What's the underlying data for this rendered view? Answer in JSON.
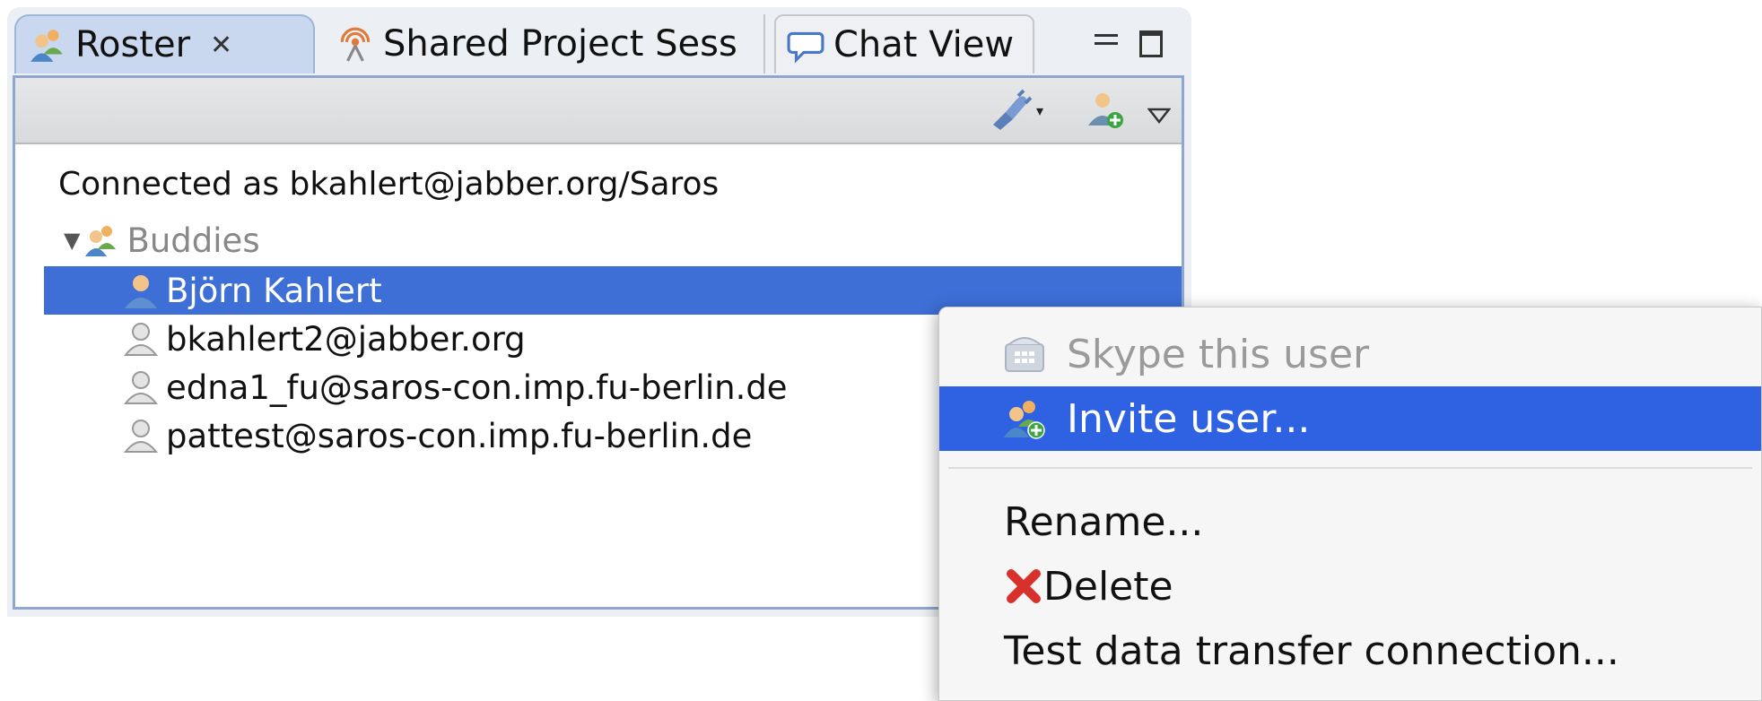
{
  "tabs": {
    "roster": "Roster",
    "roster_close": "✕",
    "shared": "Shared Project Sess",
    "chat": "Chat View"
  },
  "roster": {
    "status": "Connected as bkahlert@jabber.org/Saros",
    "group_label": "Buddies",
    "contacts": [
      {
        "name": "Björn Kahlert",
        "selected": true
      },
      {
        "name": "bkahlert2@jabber.org",
        "selected": false
      },
      {
        "name": "edna1_fu@saros-con.imp.fu-berlin.de",
        "selected": false
      },
      {
        "name": "pattest@saros-con.imp.fu-berlin.de",
        "selected": false
      }
    ]
  },
  "context_menu": {
    "items": [
      {
        "label": "Skype this user",
        "enabled": false,
        "icon": "skype-phone-icon"
      },
      {
        "label": "Invite user...",
        "enabled": true,
        "highlighted": true,
        "icon": "invite-user-icon"
      },
      {
        "label": "Rename...",
        "enabled": true
      },
      {
        "label": "Delete",
        "enabled": true,
        "icon": "red-x-icon"
      },
      {
        "label": "Test data transfer connection...",
        "enabled": true
      }
    ]
  },
  "colors": {
    "selection": "#3d6fd6",
    "menu_highlight": "#2f62e3",
    "panel_border": "#8fa7cf"
  }
}
